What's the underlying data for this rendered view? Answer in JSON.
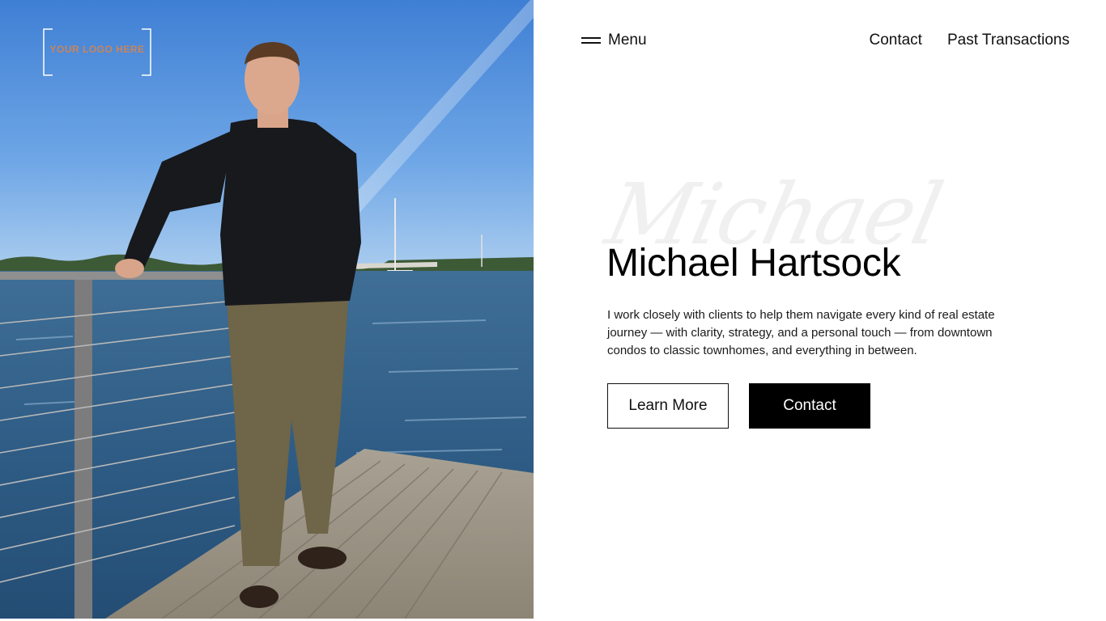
{
  "logo": {
    "text": "YOUR LOGO HERE"
  },
  "header": {
    "menu_label": "Menu",
    "nav": [
      {
        "label": "Contact"
      },
      {
        "label": "Past Transactions"
      }
    ]
  },
  "hero": {
    "script_name": "Michael",
    "name": "Michael Hartsock",
    "description": "I work closely with clients to help them navigate every kind of real estate journey — with clarity, strategy, and a personal touch — from downtown condos to classic townhomes, and everything in between.",
    "primary_button": "Learn More",
    "secondary_button": "Contact"
  },
  "icons": {
    "menu": "hamburger-icon"
  },
  "colors": {
    "accent": "#000000",
    "logo": "#c9855a",
    "background": "#ffffff"
  }
}
